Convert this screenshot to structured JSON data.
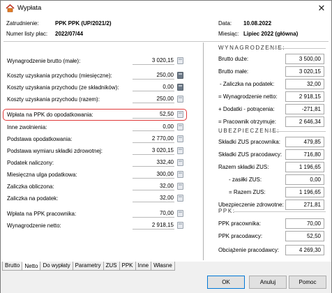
{
  "window": {
    "title": "Wypłata",
    "close_glyph": "✕"
  },
  "header": {
    "employee_label": "Zatrudnienie:",
    "employee_value": "PPK PPK (UP/2021/2)",
    "list_label": "Numer listy płac:",
    "list_value": "2022/07/44",
    "date_label": "Data:",
    "date_value": "10.08.2022",
    "month_label": "Miesiąc:",
    "month_value": "Lipiec 2022 (główna)"
  },
  "left_rows": [
    {
      "label": "Wynagrodzenie brutto (małe):",
      "value": "3 020,15"
    },
    {
      "label": "Koszty uzyskania przychodu (miesięczne):",
      "value": "250,00"
    },
    {
      "label": "Koszty uzyskania przychodu (ze składników):",
      "value": "0,00"
    },
    {
      "label": "Koszty uzyskania przychodu (razem):",
      "value": "250,00"
    },
    {
      "label": "Wpłata na PPK do opodatkowania:",
      "value": "52,50"
    },
    {
      "label": "Inne zwolnienia:",
      "value": "0,00"
    },
    {
      "label": "Podstawa opodatkowania:",
      "value": "2 770,00"
    },
    {
      "label": "Podstawa wymiaru składki zdrowotnej:",
      "value": "3 020,15"
    },
    {
      "label": "Podatek naliczony:",
      "value": "332,40"
    },
    {
      "label": "Miesięczna ulga podatkowa:",
      "value": "300,00"
    },
    {
      "label": "Zaliczka obliczona:",
      "value": "32,00"
    },
    {
      "label": "Zaliczka na podatek:",
      "value": "32,00"
    },
    {
      "label": "Wpłata na PPK pracownika:",
      "value": "70,00"
    },
    {
      "label": "Wynagrodzenie netto:",
      "value": "2 918,15"
    }
  ],
  "right": {
    "wyn_title": "WYNAGRODZENIE:",
    "wyn": [
      {
        "label": "Brutto duże:",
        "value": "3 500,00"
      },
      {
        "label": "Brutto małe:",
        "value": "3 020,15"
      },
      {
        "label": "- Zaliczka na podatek:",
        "value": "32,00"
      },
      {
        "label": "= Wynagrodzenie netto:",
        "value": "2 918,15"
      },
      {
        "label": "+ Dodatki - potrącenia:",
        "value": "-271,81"
      },
      {
        "label": "= Pracownik otrzymuje:",
        "value": "2 646,34"
      }
    ],
    "ubz_title": "UBEZPIECZENIE:",
    "ubz": [
      {
        "label": "Składki ZUS pracownika:",
        "value": "479,85"
      },
      {
        "label": "Składki ZUS pracodawcy:",
        "value": "716,80"
      },
      {
        "label": "Razem składki ZUS:",
        "value": "1 196,65"
      },
      {
        "label": "- zasiłki ZUS:",
        "value": "0,00"
      },
      {
        "label": "= Razem ZUS:",
        "value": "1 196,65"
      },
      {
        "label": "Ubezpieczenie zdrowotne:",
        "value": "271,81"
      }
    ],
    "ppk_title": "PPK:",
    "ppk": [
      {
        "label": "PPK pracownika:",
        "value": "70,00"
      },
      {
        "label": "PPK pracodawcy:",
        "value": "52,50"
      }
    ],
    "cost_label": "Obciążenie pracodawcy:",
    "cost_value": "4 269,30"
  },
  "tabs": [
    "Brutto",
    "Netto",
    "Do wypłaty",
    "Parametry",
    "ZUS",
    "PPK",
    "Inne",
    "Własne"
  ],
  "buttons": {
    "ok": "OK",
    "cancel": "Anuluj",
    "help": "Pomoc"
  }
}
